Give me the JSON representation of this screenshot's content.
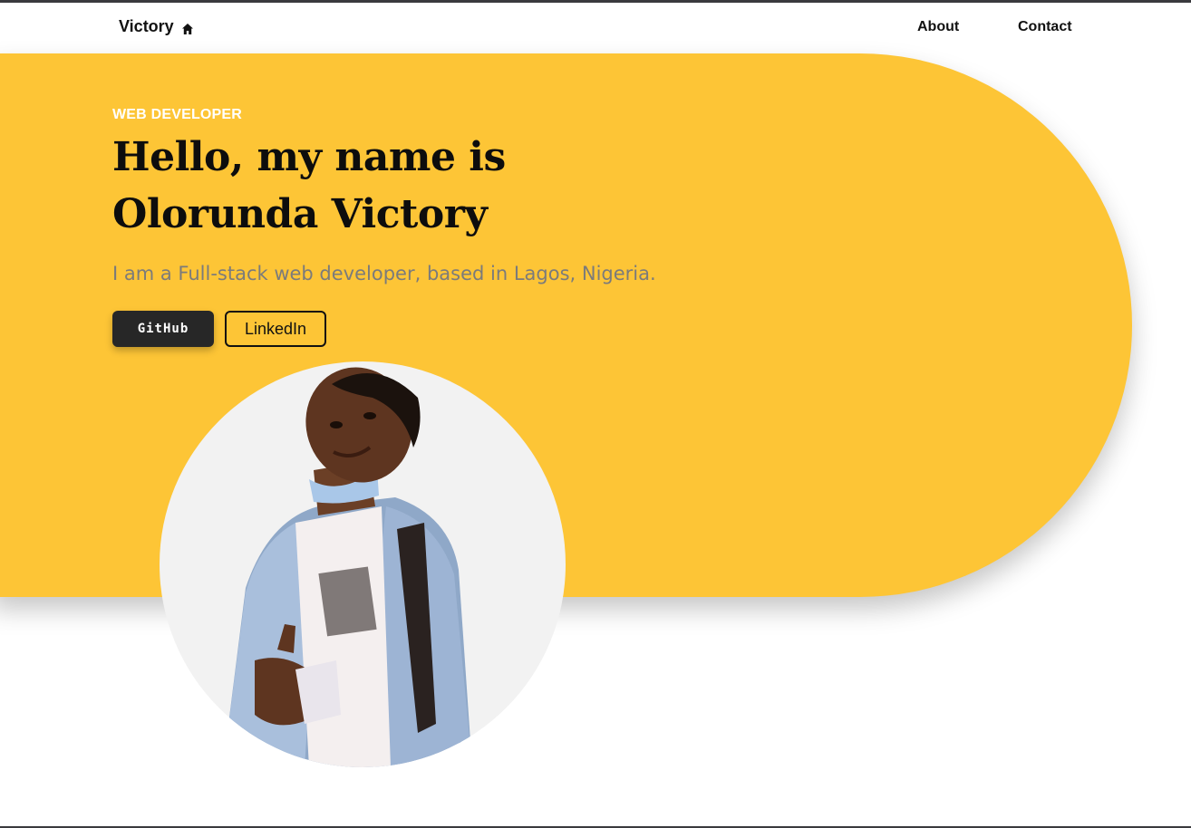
{
  "nav": {
    "brand": "Victory",
    "brand_icon": "home-icon",
    "links": [
      {
        "label": "About"
      },
      {
        "label": "Contact"
      }
    ]
  },
  "hero": {
    "eyebrow": "WEB DEVELOPER",
    "headline": "Hello, my name is Olorunda Victory",
    "tagline": "I am a Full-stack web developer, based in Lagos, Nigeria.",
    "buttons": {
      "github": "GitHub",
      "linkedin": "LinkedIn"
    },
    "accent_color": "#FDC536",
    "portrait_bg": "#f2f2f2"
  }
}
